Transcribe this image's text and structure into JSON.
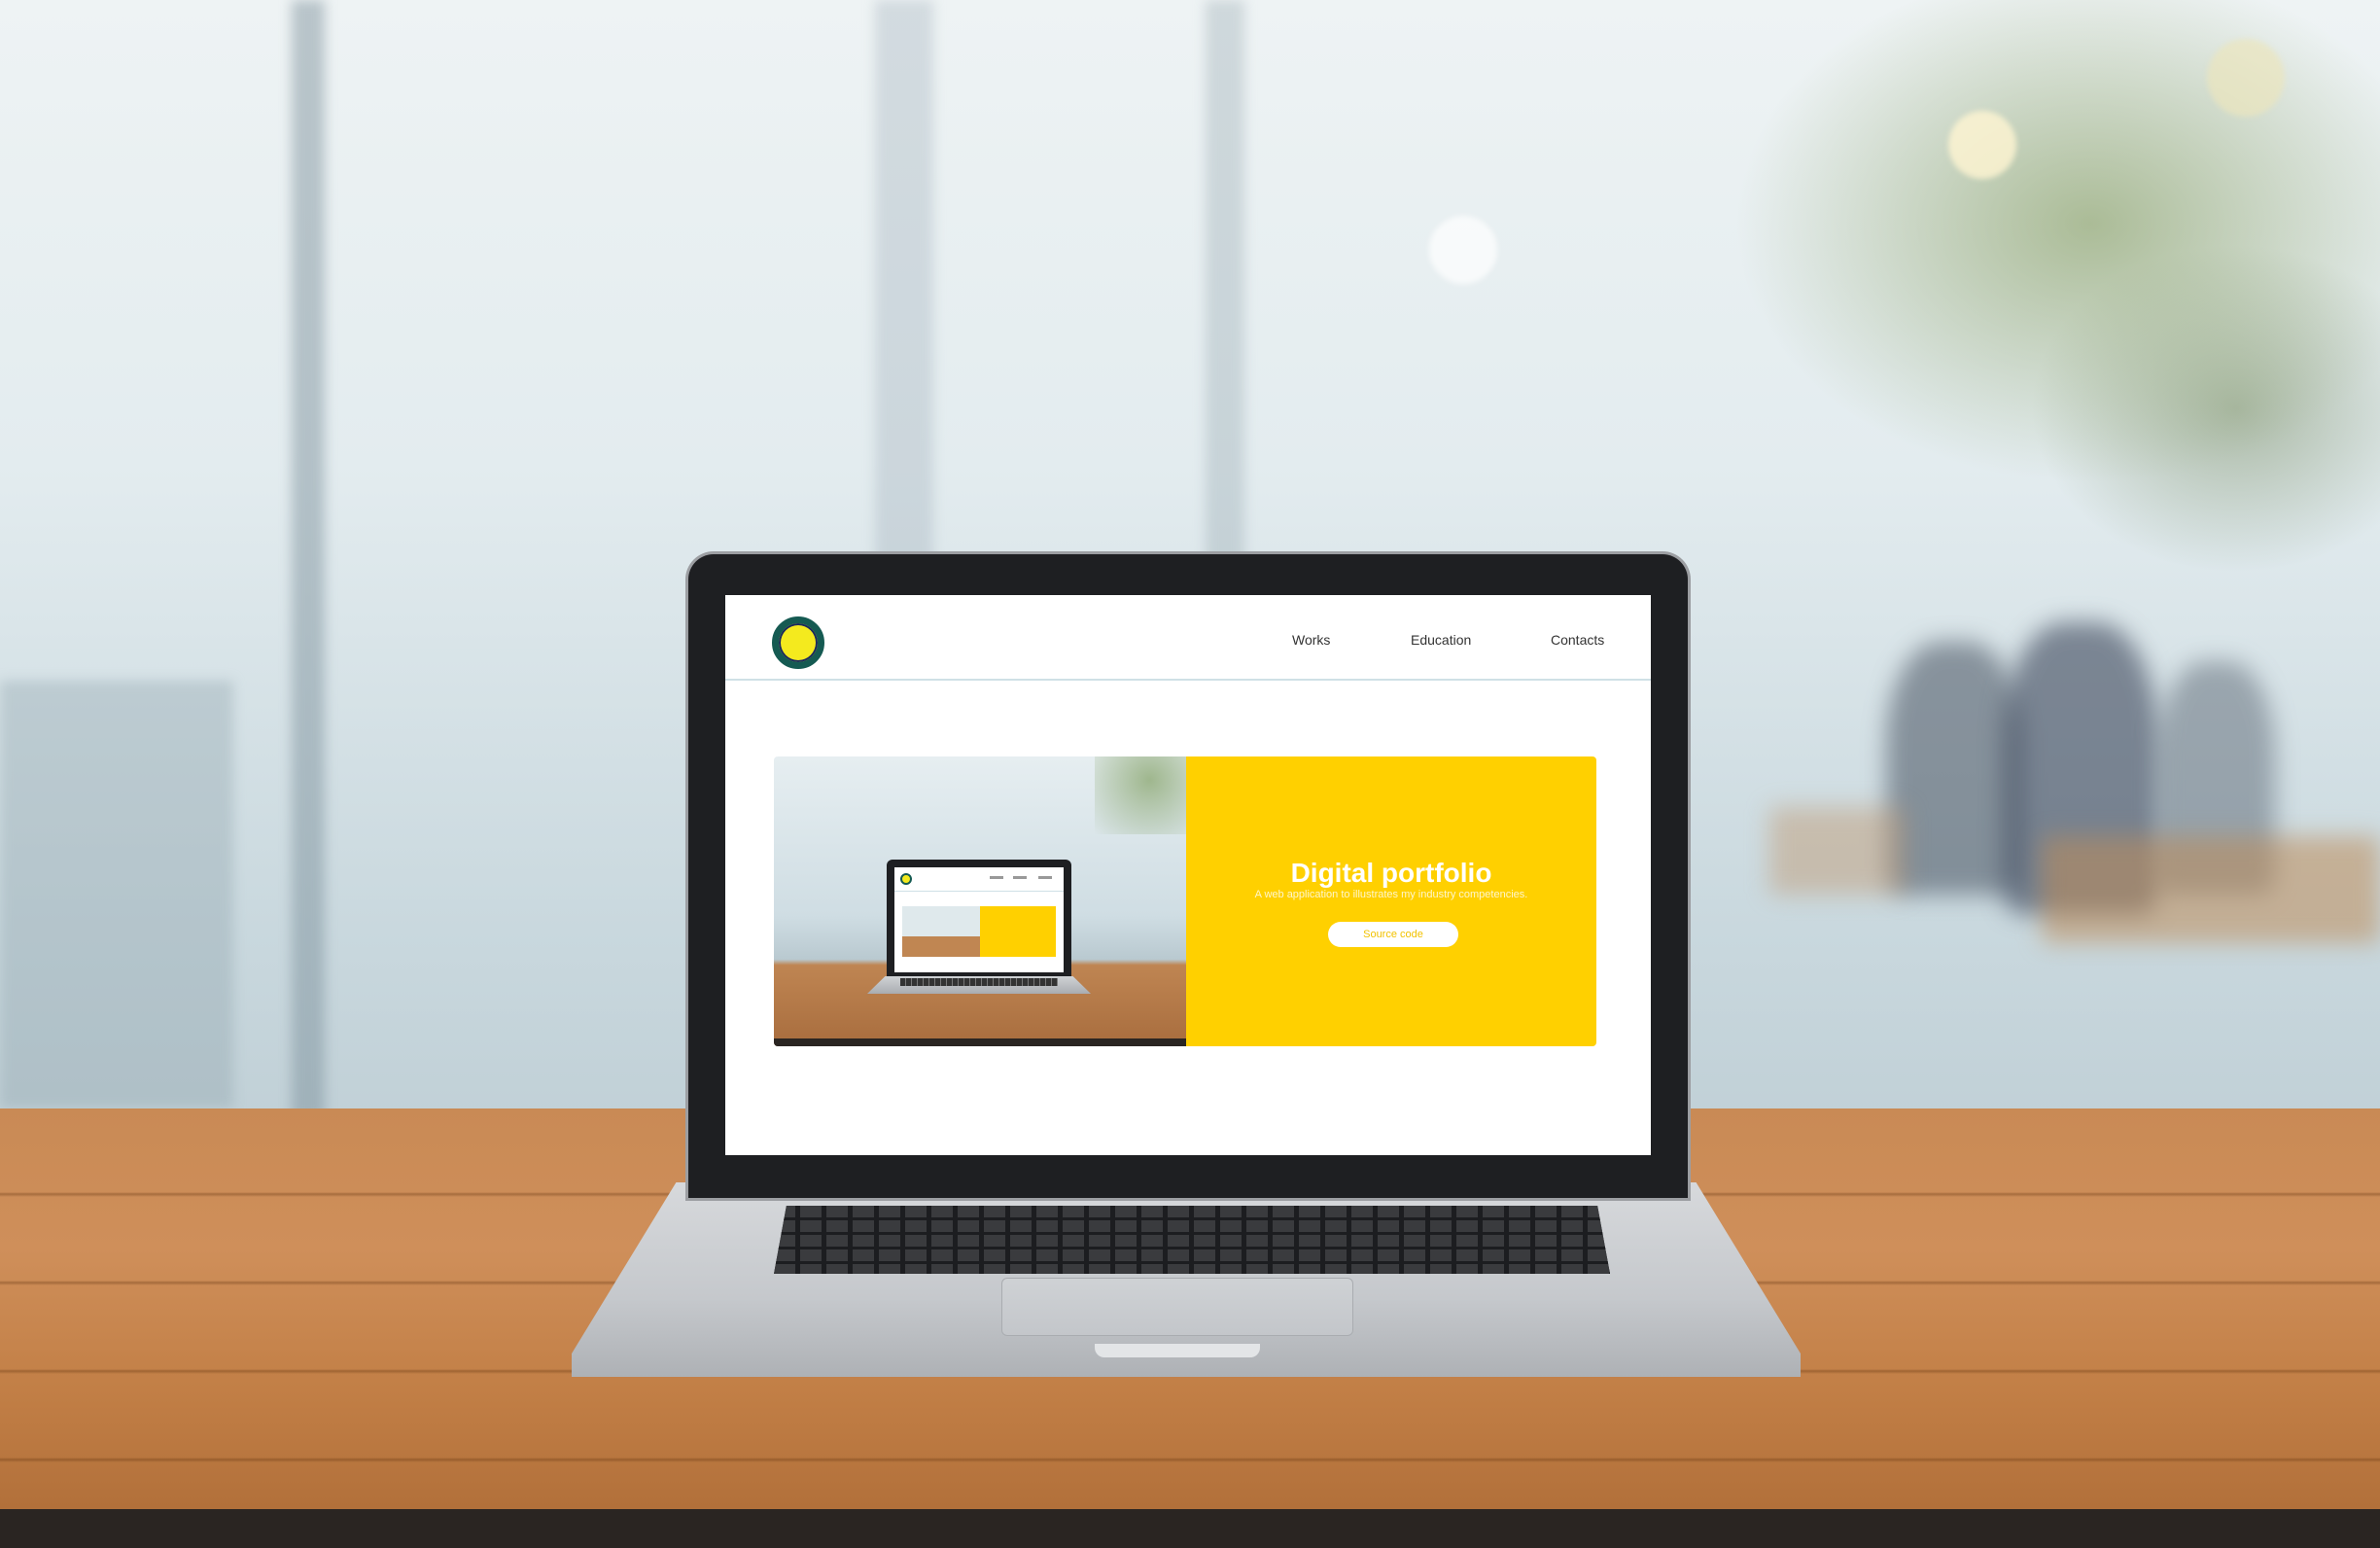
{
  "site": {
    "nav": {
      "works": "Works",
      "education": "Education",
      "contacts": "Contacts"
    },
    "project": {
      "title": "Digital portfolio",
      "subtitle": "A web application to illustrates my industry competencies.",
      "button_label": "Source code"
    }
  },
  "icons": {
    "logo": "circle-logo-icon"
  },
  "colors": {
    "accent_yellow": "#ffd000",
    "logo_ring": "#155a52",
    "logo_fill": "#f4ea1e",
    "page_background": "#ffffff"
  }
}
